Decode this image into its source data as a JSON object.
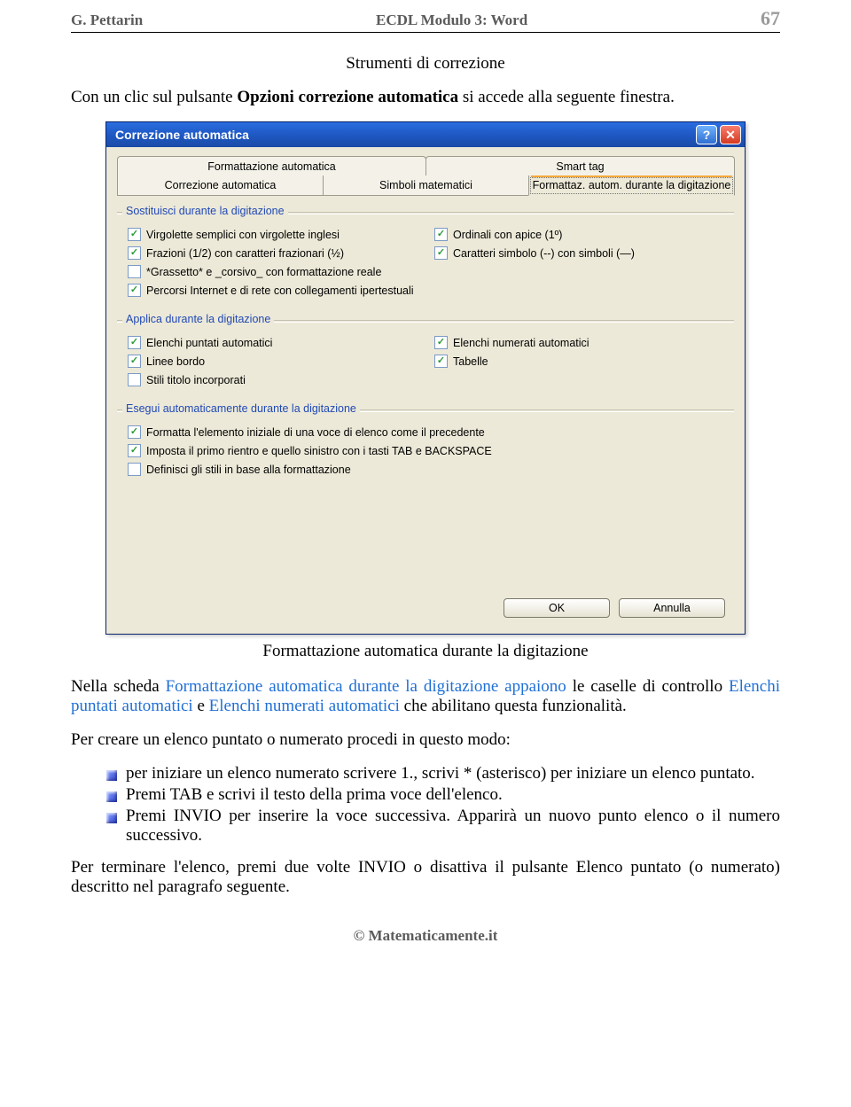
{
  "header": {
    "author": "G. Pettarin",
    "title": "ECDL Modulo 3: Word",
    "page_number": "67"
  },
  "section_title": "Strumenti di correzione",
  "intro": {
    "before_bold": "Con un clic sul pulsante ",
    "bold": "Opzioni correzione automatica",
    "after_bold": " si accede alla seguente finestra."
  },
  "dialog": {
    "title": "Correzione automatica",
    "help_icon": "?",
    "close_icon": "✕",
    "tabs_top": [
      "Formattazione automatica",
      "Smart tag"
    ],
    "tabs_bottom": [
      "Correzione automatica",
      "Simboli matematici",
      "Formattaz. autom. durante la digitazione"
    ],
    "group1": {
      "label": "Sostituisci durante la digitazione",
      "items": [
        {
          "checked": true,
          "label": "Virgolette semplici con virgolette inglesi"
        },
        {
          "checked": true,
          "label": "Ordinali con apice (1º)"
        },
        {
          "checked": true,
          "label": "Frazioni (1/2) con caratteri frazionari (½)"
        },
        {
          "checked": true,
          "label": "Caratteri simbolo (--) con simboli (—)"
        },
        {
          "checked": false,
          "label": "*Grassetto* e _corsivo_ con formattazione reale"
        },
        {
          "checked": true,
          "label": "Percorsi Internet e di rete con collegamenti ipertestuali"
        }
      ]
    },
    "group2": {
      "label": "Applica durante la digitazione",
      "items": [
        {
          "checked": true,
          "label": "Elenchi puntati automatici"
        },
        {
          "checked": true,
          "label": "Elenchi numerati automatici"
        },
        {
          "checked": true,
          "label": "Linee bordo"
        },
        {
          "checked": true,
          "label": "Tabelle"
        },
        {
          "checked": false,
          "label": "Stili titolo incorporati"
        }
      ]
    },
    "group3": {
      "label": "Esegui automaticamente durante la digitazione",
      "items": [
        {
          "checked": true,
          "label": "Formatta l'elemento iniziale di una voce di elenco come il precedente"
        },
        {
          "checked": true,
          "label": "Imposta il primo rientro e quello sinistro con i tasti TAB e BACKSPACE"
        },
        {
          "checked": false,
          "label": "Definisci gli stili in base alla formattazione"
        }
      ]
    },
    "ok_label": "OK",
    "cancel_label": "Annulla"
  },
  "caption": "Formattazione automatica durante la digitazione",
  "para2": {
    "p0": "Nella scheda ",
    "h0": "Formattazione automatica durante la digitazione appaiono",
    "p1": " le caselle di controllo ",
    "h1": "Elenchi puntati automatici",
    "p2": " e ",
    "h2": "Elenchi numerati automatici",
    "p3": " che abilitano questa funzionalità."
  },
  "para3": "Per creare un elenco puntato o numerato procedi in questo modo:",
  "bullets": [
    "per iniziare un elenco numerato scrivere 1., scrivi * (asterisco) per iniziare un elenco puntato.",
    "Premi TAB e scrivi il testo della prima voce dell'elenco.",
    "Premi INVIO per inserire la voce successiva. Apparirà un nuovo punto elenco o il numero successivo."
  ],
  "para4": "Per terminare l'elenco, premi due volte INVIO o disattiva il pulsante Elenco puntato (o numerato) descritto nel paragrafo seguente.",
  "footer": "© Matematicamente.it"
}
